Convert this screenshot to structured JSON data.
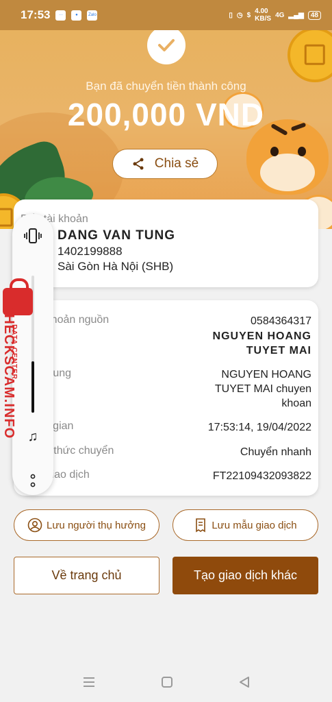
{
  "status_bar": {
    "time": "17:53",
    "app_label": "Zalo",
    "net_speed": "4.00",
    "net_unit": "KB/S",
    "network": "4G",
    "battery": "48"
  },
  "hero": {
    "caption": "Bạn đã chuyển tiền thành công",
    "amount": "200,000 VND",
    "share_label": "Chia sẻ"
  },
  "recipient": {
    "label": "Đến tài khoản",
    "name": "DANG VAN TUNG",
    "account": "1402199888",
    "bank": "Sài Gòn Hà Nội (SHB)"
  },
  "details": [
    {
      "label": "Tài khoản nguồn",
      "value": "0584364317"
    },
    {
      "label": "",
      "value": "NGUYEN HOANG\nTUYET MAI"
    },
    {
      "label": "Nội dung",
      "value": "NGUYEN HOANG\nTUYET MAI chuyen\nkhoan"
    },
    {
      "label": "Thời gian",
      "value": "17:53:14, 19/04/2022"
    },
    {
      "label": "Hình thức chuyển",
      "value": "Chuyển nhanh"
    },
    {
      "label": "Mã giao dịch",
      "value": "FT22109432093822"
    }
  ],
  "actions": {
    "save_beneficiary": "Lưu người thụ hưởng",
    "save_template": "Lưu mẫu giao dịch",
    "home": "Về trang chủ",
    "new_transaction": "Tạo giao dịch khác"
  },
  "watermark": {
    "brand": "CHECKSCAM.INFO",
    "tag": "DATA CENTER"
  },
  "colors": {
    "accent": "#8f4a0c",
    "hero": "#e9b064",
    "watermark": "#d92c2c"
  }
}
